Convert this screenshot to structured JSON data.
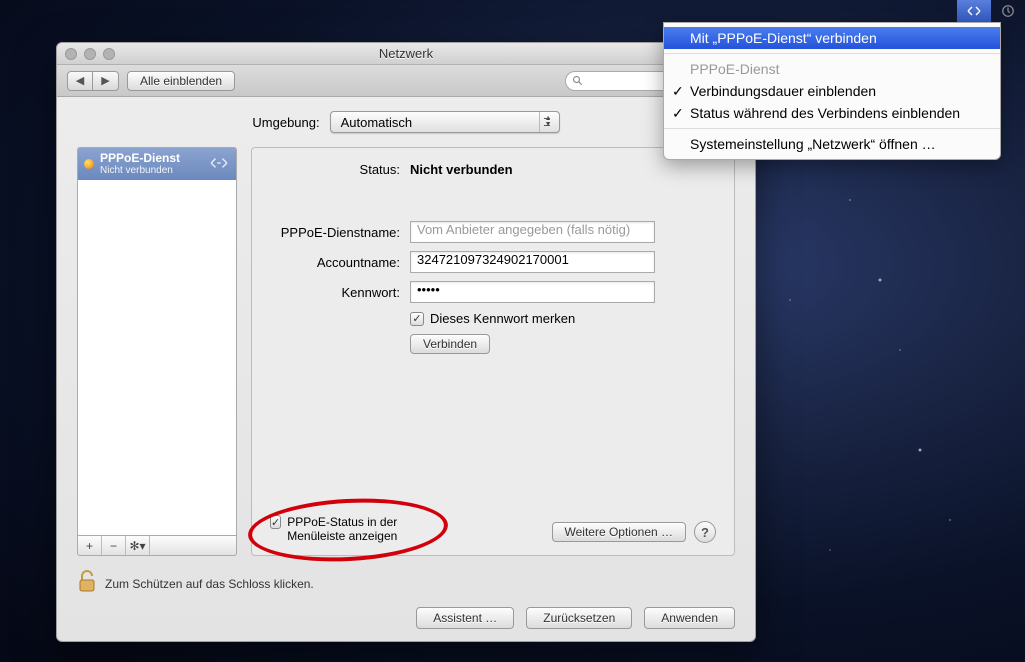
{
  "menubar": {
    "dropdown": {
      "connect": "Mit „PPPoE-Dienst“ verbinden",
      "service": "PPPoE-Dienst",
      "showDuration": "Verbindungsdauer einblenden",
      "showStatus": "Status während des Verbindens einblenden",
      "openPrefs": "Systemeinstellung „Netzwerk“ öffnen …"
    }
  },
  "window": {
    "title": "Netzwerk",
    "toolbar": {
      "showAll": "Alle einblenden"
    },
    "environment": {
      "label": "Umgebung:",
      "value": "Automatisch"
    },
    "sidebar": {
      "service": {
        "name": "PPPoE-Dienst",
        "status": "Nicht verbunden"
      }
    },
    "detail": {
      "statusLabel": "Status:",
      "statusValue": "Nicht verbunden",
      "pppoeNameLabel": "PPPoE-Dienstname:",
      "pppoeNamePlaceholder": "Vom Anbieter angegeben (falls nötig)",
      "accountLabel": "Accountname:",
      "accountValue": "324721097324902170001",
      "passwordLabel": "Kennwort:",
      "passwordValue": "•••••",
      "rememberLabel": "Dieses Kennwort merken",
      "connectBtn": "Verbinden",
      "menubarCheck": "PPPoE-Status in der Menüleiste anzeigen",
      "moreOptions": "Weitere Optionen …"
    },
    "lockText": "Zum Schützen auf das Schloss klicken.",
    "buttons": {
      "assistant": "Assistent …",
      "revert": "Zurücksetzen",
      "apply": "Anwenden"
    }
  }
}
